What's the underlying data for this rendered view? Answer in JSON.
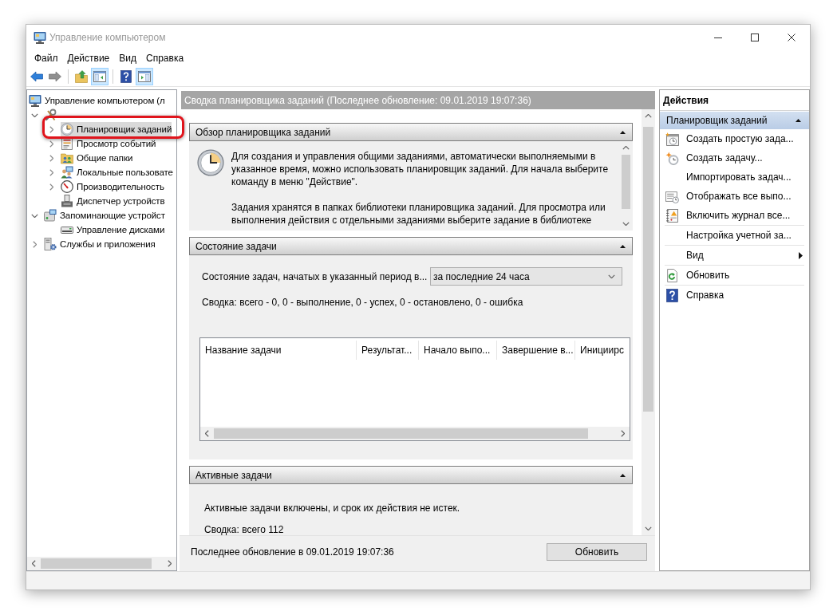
{
  "window": {
    "title": "Управление компьютером"
  },
  "menu": [
    "Файл",
    "Действие",
    "Вид",
    "Справка"
  ],
  "toolbar": {
    "groups": [
      [
        {
          "pressed": false,
          "disabled": false
        },
        {
          "pressed": false,
          "disabled": true
        }
      ],
      [
        {
          "pressed": false,
          "disabled": false
        },
        {
          "pressed": true,
          "disabled": false
        }
      ],
      [
        {
          "pressed": false,
          "disabled": false
        },
        {
          "pressed": true,
          "disabled": false
        }
      ]
    ]
  },
  "tree": [
    {
      "label": "Управление компьютером (л",
      "selected": false,
      "highlighted": false,
      "children": [
        {
          "expanded": true,
          "selected": false,
          "highlighted": false,
          "children": [
            {
              "label": "Планировщик заданий",
              "expanded": false,
              "selected": true,
              "highlighted": true
            },
            {
              "label": "Просмотр событий",
              "expanded": false,
              "selected": false,
              "highlighted": false
            },
            {
              "label": "Общие папки",
              "expanded": false,
              "selected": false,
              "highlighted": false
            },
            {
              "label": "Локальные пользовате",
              "expanded": false,
              "selected": false,
              "highlighted": false
            },
            {
              "label": "Производительность",
              "expanded": false,
              "selected": false,
              "highlighted": false
            },
            {
              "label": "Диспетчер устройств",
              "selected": false,
              "highlighted": false
            }
          ]
        },
        {
          "label": "Запоминающие устройст",
          "expanded": true,
          "selected": false,
          "highlighted": false,
          "children": [
            {
              "label": "Управление дисками",
              "selected": false,
              "highlighted": false
            }
          ]
        },
        {
          "label": "Службы и приложения",
          "expanded": false,
          "selected": false,
          "highlighted": false
        }
      ]
    }
  ],
  "center": {
    "header": "Сводка планировщика заданий (Последнее обновление: 09.01.2019 19:07:36)",
    "sections": [
      {
        "kind": "overview",
        "title": "Обзор планировщика заданий",
        "expanded": true,
        "paragraphs": [
          "Для создания и управления общими заданиями, автоматически выполняемыми в указанное время, можно использовать планировщик заданий. Для начала выберите команду в меню \"Действие\".",
          "Задания хранятся в папках библиотеки планировщика заданий. Для просмотра или выполнения действия с отдельными заданиями выберите задание в библиотеке"
        ]
      },
      {
        "kind": "status",
        "title": "Состояние задачи",
        "expanded": true,
        "period_label": "Состояние задач, начатых в указанный период в...",
        "period_value": "за последние 24 часа",
        "summary": "Сводка: всего - 0, 0 - выполнение, 0 - успех, 0 - остановлено, 0 - ошибка",
        "table": {
          "columns": [
            "Название задачи",
            "Результат...",
            "Начало выпо...",
            "Завершение в...",
            "Инициирс"
          ]
        }
      },
      {
        "kind": "active",
        "title": "Активные задачи",
        "expanded": true,
        "lines": [
          "Активные задачи включены, и срок их действия не истек.",
          "Сводка: всего 112"
        ]
      }
    ],
    "footer": {
      "text": "Последнее обновление в 09.01.2019 19:07:36",
      "button": "Обновить"
    }
  },
  "actions": {
    "title": "Действия",
    "groups": [
      {
        "title": "Планировщик заданий",
        "expanded": true,
        "item_groups": [
          [
            {
              "label": "Создать простую зада...",
              "kind": "command"
            },
            {
              "label": "Создать задачу...",
              "kind": "command"
            },
            {
              "label": "Импортировать задач...",
              "kind": "command"
            },
            {
              "label": "Отображать все выпо...",
              "kind": "command"
            },
            {
              "label": "Включить журнал все...",
              "kind": "command"
            }
          ],
          [
            {
              "label": "Настройка учетной за...",
              "kind": "command"
            }
          ],
          [
            {
              "label": "Вид",
              "kind": "submenu"
            }
          ],
          [
            {
              "label": "Обновить",
              "kind": "command"
            }
          ],
          [
            {
              "label": "Справка",
              "kind": "command"
            }
          ]
        ]
      }
    ]
  }
}
